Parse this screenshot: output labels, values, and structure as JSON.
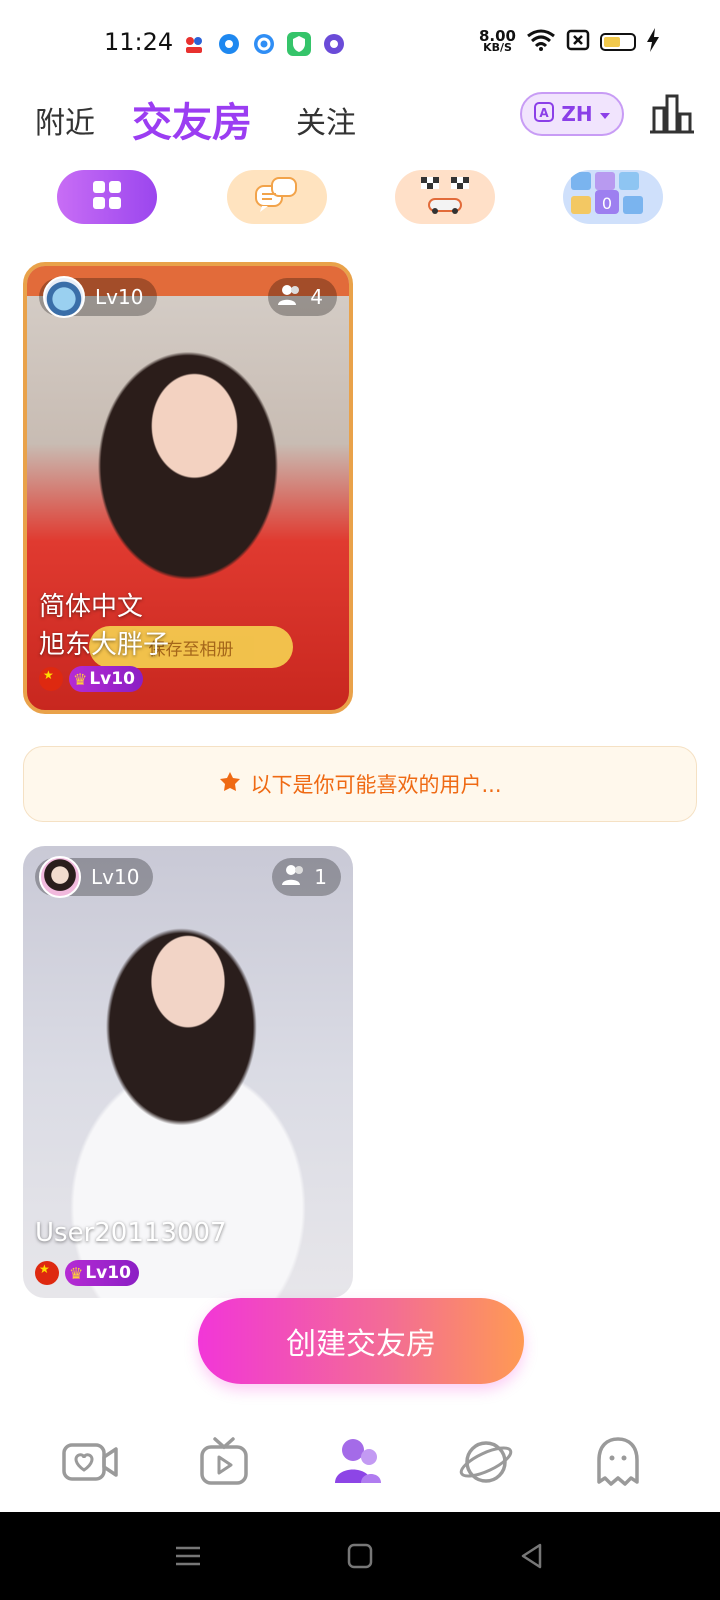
{
  "status_bar": {
    "time": "11:24",
    "net_speed_value": "8.00",
    "net_speed_unit": "KB/S"
  },
  "header": {
    "tabs": [
      {
        "label": "附近"
      },
      {
        "label": "交友房"
      },
      {
        "label": "关注"
      }
    ],
    "active_tab": "交友房",
    "language": "ZH",
    "accent_color": "#9b3df2"
  },
  "categories": [
    {
      "icon": "grid-icon",
      "active": true
    },
    {
      "icon": "chat-bubbles-icon",
      "active": false
    },
    {
      "icon": "racing-flags-icon",
      "active": false
    },
    {
      "icon": "number-puzzle-icon",
      "active": false
    }
  ],
  "rooms": [
    {
      "host_level": "Lv10",
      "member_count": "4",
      "title": "简体中文",
      "host_name": "旭东大胖子",
      "badge_level": "Lv10",
      "overlay_text": "保存至相册"
    },
    {
      "host_level": "Lv10",
      "member_count": "1",
      "host_name": "User20113007",
      "badge_level": "Lv10"
    }
  ],
  "recommend_banner": "以下是你可能喜欢的用户...",
  "create_button": "创建交友房",
  "bottom_tabs": [
    {
      "icon": "video-heart-icon",
      "active": false
    },
    {
      "icon": "tv-play-icon",
      "active": false
    },
    {
      "icon": "friends-icon",
      "active": true
    },
    {
      "icon": "planet-icon",
      "active": false
    },
    {
      "icon": "ghost-icon",
      "active": false
    }
  ]
}
